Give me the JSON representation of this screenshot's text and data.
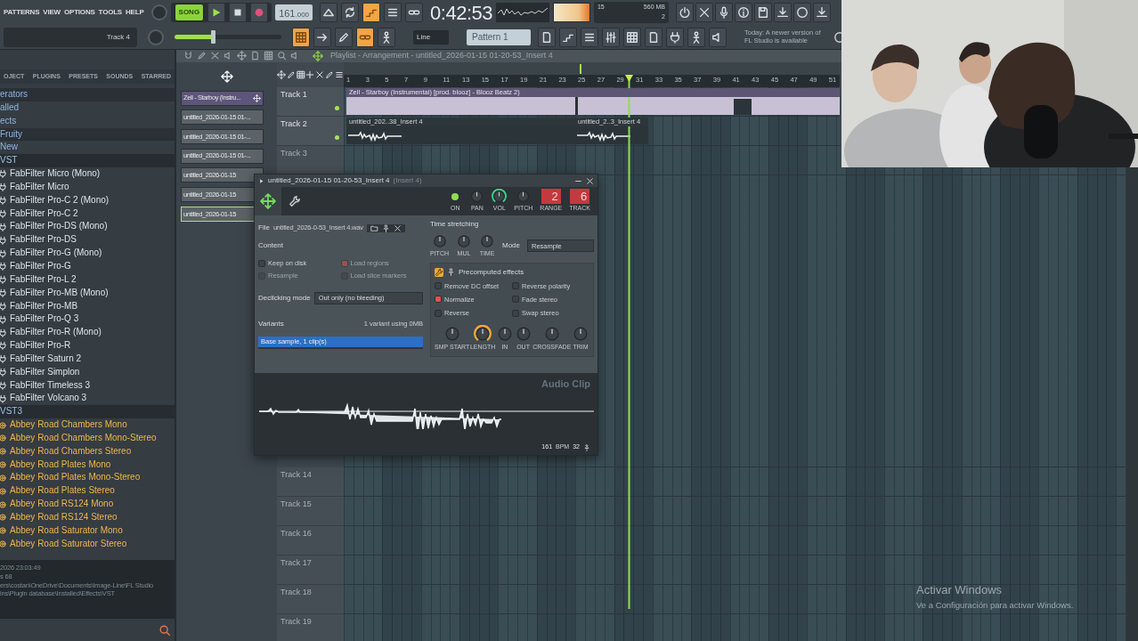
{
  "menu": [
    "PATTERNS",
    "VIEW",
    "OPTIONS",
    "TOOLS",
    "HELP"
  ],
  "transport": {
    "song_mode": true,
    "mode_label": "SONG",
    "tempo": "161",
    "tempo_fraction": ".000"
  },
  "time": "0:42:53",
  "monitor": {
    "cpu": "15",
    "memory": "560 MB",
    "polyphony": "2"
  },
  "track_label": "Track 4",
  "master_volume": {
    "level": 0.36
  },
  "snap": "Line",
  "pattern": "Pattern 1",
  "hint": "Today: A newer version of FL Studio is available",
  "toolbar_row1_left": [
    {
      "active": false
    },
    {
      "active": false
    },
    {
      "active": true
    },
    {
      "active": false
    },
    {
      "active": false
    }
  ],
  "toolbar_row1_right": [
    {
      "active": false
    },
    {
      "active": false
    },
    {
      "active": false
    },
    {
      "active": false
    },
    {
      "active": false
    },
    {
      "active": false
    },
    {
      "active": false
    },
    {
      "active": false
    }
  ],
  "toolbar_row2_left": [
    {
      "active": true
    },
    {
      "active": false
    },
    {
      "active": false
    },
    {
      "active": true
    },
    {
      "active": false
    }
  ],
  "toolbar_row2_right": [
    {
      "active": false
    },
    {
      "active": false
    },
    {
      "active": false
    },
    {
      "active": false
    },
    {
      "active": false
    },
    {
      "active": false
    },
    {
      "active": false
    },
    {
      "active": false
    },
    {
      "active": false
    }
  ],
  "browser": {
    "tabs": [
      "OJECT",
      "PLUGINS",
      "PRESETS",
      "SOUNDS",
      "STARRED"
    ],
    "items": [
      {
        "kind": "folder",
        "label": "erators",
        "highlighted": true
      },
      {
        "kind": "folder",
        "label": "alled",
        "highlighted": false
      },
      {
        "kind": "folder",
        "label": "ects",
        "highlighted": false
      },
      {
        "kind": "folder",
        "label": "Fruity",
        "highlighted": true
      },
      {
        "kind": "folder",
        "label": "New",
        "highlighted": false
      },
      {
        "kind": "header",
        "label": "VST",
        "highlighted": true
      },
      {
        "kind": "plugin",
        "label": "FabFilter Micro (Mono)",
        "highlighted": false
      },
      {
        "kind": "plugin",
        "label": "FabFilter Micro",
        "highlighted": false
      },
      {
        "kind": "plugin",
        "label": "FabFilter Pro-C 2 (Mono)",
        "highlighted": false
      },
      {
        "kind": "plugin",
        "label": "FabFilter Pro-C 2",
        "highlighted": false
      },
      {
        "kind": "plugin",
        "label": "FabFilter Pro-DS (Mono)",
        "highlighted": false
      },
      {
        "kind": "plugin",
        "label": "FabFilter Pro-DS",
        "highlighted": false
      },
      {
        "kind": "plugin",
        "label": "FabFilter Pro-G (Mono)",
        "highlighted": false
      },
      {
        "kind": "plugin",
        "label": "FabFilter Pro-G",
        "highlighted": false
      },
      {
        "kind": "plugin",
        "label": "FabFilter Pro-L 2",
        "highlighted": false
      },
      {
        "kind": "plugin",
        "label": "FabFilter Pro-MB (Mono)",
        "highlighted": false
      },
      {
        "kind": "plugin",
        "label": "FabFilter Pro-MB",
        "highlighted": false
      },
      {
        "kind": "plugin",
        "label": "FabFilter Pro-Q 3",
        "highlighted": false
      },
      {
        "kind": "plugin",
        "label": "FabFilter Pro-R (Mono)",
        "highlighted": false
      },
      {
        "kind": "plugin",
        "label": "FabFilter Pro-R",
        "highlighted": false
      },
      {
        "kind": "plugin",
        "label": "FabFilter Saturn 2",
        "highlighted": false
      },
      {
        "kind": "plugin",
        "label": "FabFilter Simplon",
        "highlighted": false
      },
      {
        "kind": "plugin",
        "label": "FabFilter Timeless 3",
        "highlighted": false
      },
      {
        "kind": "plugin",
        "label": "FabFilter Volcano 3",
        "highlighted": false
      },
      {
        "kind": "header",
        "label": "VST3",
        "highlighted": true
      },
      {
        "kind": "vst3",
        "label": "Abbey Road Chambers Mono",
        "highlighted": false
      },
      {
        "kind": "vst3",
        "label": "Abbey Road Chambers Mono-Stereo",
        "highlighted": false
      },
      {
        "kind": "vst3",
        "label": "Abbey Road Chambers Stereo",
        "highlighted": false
      },
      {
        "kind": "vst3",
        "label": "Abbey Road Plates Mono",
        "highlighted": false
      },
      {
        "kind": "vst3",
        "label": "Abbey Road Plates Mono-Stereo",
        "highlighted": false
      },
      {
        "kind": "vst3",
        "label": "Abbey Road Plates Stereo",
        "highlighted": false
      },
      {
        "kind": "vst3",
        "label": "Abbey Road RS124 Mono",
        "highlighted": false
      },
      {
        "kind": "vst3",
        "label": "Abbey Road RS124 Stereo",
        "highlighted": false
      },
      {
        "kind": "vst3",
        "label": "Abbey Road Saturator Mono",
        "highlighted": false
      },
      {
        "kind": "vst3",
        "label": "Abbey Road Saturator Stereo",
        "highlighted": false
      }
    ],
    "info": [
      "2026 23:03:49",
      "s 68",
      "ers\\costan\\OneDrive\\Documents\\Image-Line\\FL Studio",
      "ins\\Plugin database\\Installed\\Effects\\VST"
    ]
  },
  "playlist": {
    "title": "Playlist - Arrangement - untitled_2026-01-15 01-20-53_Insert 4",
    "picker": [
      {
        "label": "Zell - Starboy (Instru...",
        "color": "#5e557a",
        "selected": false
      },
      {
        "label": "untitled_2026-01-15 01-...",
        "color": "#5c6367",
        "selected": false
      },
      {
        "label": "untitled_2026-01-15 01-...",
        "color": "#5c6367",
        "selected": false
      },
      {
        "label": "untitled_2026-01-15 01-...",
        "color": "#5c6367",
        "selected": false
      },
      {
        "label": "untitled_2026-01-15",
        "color": "#5c6367",
        "selected": false
      },
      {
        "label": "untitled_2026-01-15",
        "color": "#5c6367",
        "selected": false
      },
      {
        "label": "untitled_2026-01-15",
        "color": "#5c6367",
        "selected": true
      }
    ],
    "ruler": [
      "1",
      "3",
      "5",
      "7",
      "9",
      "11",
      "13",
      "15",
      "17",
      "19",
      "21",
      "23",
      "25",
      "27",
      "29",
      "31",
      "33",
      "35",
      "37",
      "39",
      "41",
      "43",
      "45",
      "47",
      "49",
      "51"
    ],
    "tracks_top": [
      {
        "name": "Track 1",
        "dimmed": false,
        "clips": [
          {
            "kind": "long",
            "title": "Zell - Starboy (Instrumental) [prod. blooz] - Blooz Beatz 2)"
          }
        ]
      },
      {
        "name": "Track 2",
        "dimmed": false,
        "clips": [
          {
            "kind": "short",
            "title": "untitled_202..38_Insert 4"
          },
          {
            "kind": "short",
            "title": "untitled_2..3_Insert 4"
          }
        ]
      },
      {
        "name": "Track 3",
        "dimmed": true
      }
    ],
    "tracks_bottom": [
      {
        "name": "Track 14",
        "dimmed": true
      },
      {
        "name": "Track 15",
        "dimmed": true
      },
      {
        "name": "Track 16",
        "dimmed": true
      },
      {
        "name": "Track 17",
        "dimmed": true
      },
      {
        "name": "Track 18",
        "dimmed": true
      },
      {
        "name": "Track 19",
        "dimmed": true
      }
    ]
  },
  "sample_window": {
    "title": "untitled_2026-01-15 01-20-53_Insert 4",
    "title_suffix": "(Insert 4)",
    "power_on": true,
    "power_label": "ON",
    "knobs": [
      {
        "label": "PAN",
        "selected": false
      },
      {
        "label": "VOL",
        "selected": true
      },
      {
        "label": "PITCH",
        "selected": false
      }
    ],
    "range": {
      "value": "2",
      "label": "RANGE"
    },
    "track": {
      "value": "6",
      "label": "TRACK"
    },
    "file_label": "File",
    "file_name": "untitled_2026-0-53_Insert 4.wav",
    "content_title": "Content",
    "content_options": [
      {
        "label": "Keep on disk",
        "checked": false,
        "disabled": false
      },
      {
        "label": "Load regions",
        "checked": true,
        "disabled": true
      },
      {
        "label": "Resample",
        "checked": false,
        "disabled": true
      },
      {
        "label": "Load slice markers",
        "checked": false,
        "disabled": true
      }
    ],
    "declick_label": "Declicking mode",
    "declick_value": "Out only (no bleeding)",
    "variants_label": "Variants",
    "variants_info": "1 variant using 0MB",
    "variants": [
      {
        "label": "Base sample, 1 clip(s)",
        "selected": true
      }
    ],
    "stretch_title": "Time stretching",
    "stretch_knobs": [
      "PITCH",
      "MUL",
      "TIME"
    ],
    "mode_label": "Mode",
    "mode_value": "Resample",
    "effects_title": "Precomputed effects",
    "effects": [
      {
        "label": "Remove DC offset",
        "checked": false
      },
      {
        "label": "Reverse polarity",
        "checked": false
      },
      {
        "label": "Normalize",
        "checked": true
      },
      {
        "label": "Fade stereo",
        "checked": false
      },
      {
        "label": "Reverse",
        "checked": false
      },
      {
        "label": "Swap stereo",
        "checked": false
      }
    ],
    "effect_knobs": [
      {
        "label": "SMP START",
        "selected": false
      },
      {
        "label": "LENGTH",
        "selected": true
      },
      {
        "label": "IN",
        "selected": false
      },
      {
        "label": "OUT",
        "selected": false
      },
      {
        "label": "CROSSFADE",
        "selected": false
      },
      {
        "label": "TRIM",
        "selected": false
      }
    ],
    "clip_watermark": "Audio Clip",
    "bpm": "161",
    "bpm_unit": "BPM",
    "beats": "32"
  },
  "webcam": {
    "kind": "picture"
  },
  "os_notice": {
    "title": "Activar Windows",
    "text": "Ve a Configuración para activar Windows."
  }
}
